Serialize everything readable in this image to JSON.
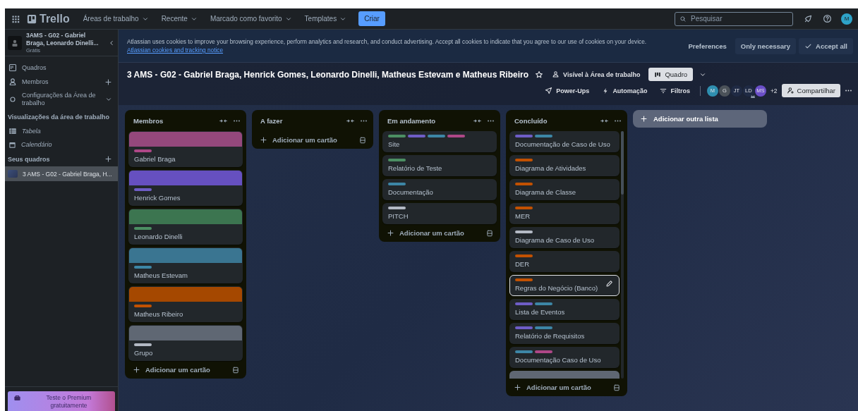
{
  "topbar": {
    "logo": "Trello",
    "menus": [
      {
        "label": "Áreas de trabalho"
      },
      {
        "label": "Recente"
      },
      {
        "label": "Marcado como favorito"
      },
      {
        "label": "Templates"
      }
    ],
    "create_button": "Criar",
    "search": {
      "placeholder": "Pesquisar"
    },
    "avatar": {
      "initials": "M",
      "color": "#2ea3c8"
    }
  },
  "sidebar": {
    "workspace": {
      "name": "3AMS - G02 - Gabriel Braga, Leonardo Dinelli...",
      "plan": "Grátis"
    },
    "items": [
      {
        "kind": "boards",
        "label": "Quadros"
      },
      {
        "kind": "members",
        "label": "Membros"
      },
      {
        "kind": "settings",
        "label": "Configurações da Área de trabalho"
      }
    ],
    "views_heading": "Visualizações da área de trabalho",
    "views": [
      {
        "kind": "table",
        "label": "Tabela"
      },
      {
        "kind": "calendar",
        "label": "Calendário"
      }
    ],
    "boards_heading": "Seus quadros",
    "boards": [
      {
        "label": "3 AMS - G02 - Gabriel Braga, H...",
        "selected": true
      }
    ],
    "premium": "Teste o Premium gratuitamente"
  },
  "cookie_banner": {
    "text": "Atlassian uses cookies to improve your browsing experience, perform analytics and research, and conduct advertising. Accept all cookies to indicate that you agree to our use of cookies on your device.",
    "link": "Atlassian cookies and tracking notice",
    "buttons": [
      {
        "kind": "plain",
        "label": "Preferences"
      },
      {
        "kind": "filled",
        "label": "Only necessary"
      },
      {
        "kind": "check",
        "label": "Accept all"
      }
    ]
  },
  "board_header": {
    "title": "3 AMS - G02 - Gabriel Braga, Henrick Gomes, Leonardo Dinelli, Matheus Estevam e Matheus Ribeiro",
    "visibility": "Visível à Área de trabalho",
    "view_button": "Quadro",
    "actions": [
      {
        "kind": "power-ups",
        "label": "Power-Ups"
      },
      {
        "kind": "automation",
        "label": "Automação"
      },
      {
        "kind": "filter",
        "label": "Filtros"
      }
    ],
    "members": [
      {
        "initials": "M",
        "color": "#2f8fb0",
        "admin": false
      },
      {
        "initials": "G",
        "color": "#4b5259",
        "admin": false
      },
      {
        "initials": "JT",
        "color": "#1f2a44",
        "admin": false
      },
      {
        "initials": "LD",
        "color": "#1f2a44",
        "admin": true
      },
      {
        "initials": "MS",
        "color": "#6b4fc8",
        "admin": false
      }
    ],
    "more_members": "+2",
    "share_button": "Compartilhar"
  },
  "lists": [
    {
      "title": "Membros",
      "add_card": "Adicionar um cartão",
      "cards": [
        {
          "kind": "cover",
          "color": "#94487c",
          "labels": [
            {
              "color": "#ae4787"
            }
          ],
          "title": "Gabriel Braga",
          "selected": false
        },
        {
          "kind": "cover",
          "color": "#6650c0",
          "labels": [
            {
              "color": "#6e5dc6"
            }
          ],
          "title": "Henrick Gomes",
          "selected": false
        },
        {
          "kind": "cover",
          "color": "#3c7550",
          "labels": [
            {
              "color": "#4c8f63"
            }
          ],
          "title": "Leonardo Dinelli",
          "selected": false
        },
        {
          "kind": "cover",
          "color": "#3a7591",
          "labels": [
            {
              "color": "#3d86a6"
            }
          ],
          "title": "Matheus Estevam",
          "selected": false
        },
        {
          "kind": "cover",
          "color": "#a54800",
          "labels": [
            {
              "color": "#c25100"
            }
          ],
          "title": "Matheus Ribeiro",
          "selected": false
        },
        {
          "kind": "cover",
          "color": "#5f6773",
          "labels": [
            {
              "color": "#b3b9c4"
            }
          ],
          "title": "Grupo",
          "selected": false
        }
      ]
    },
    {
      "title": "A fazer",
      "add_card": "Adicionar um cartão"
    },
    {
      "title": "Em andamento",
      "add_card": "Adicionar um cartão",
      "cards": [
        {
          "kind": "plain",
          "labels": [
            {
              "color": "#4c8f63"
            },
            {
              "color": "#6e5dc6"
            },
            {
              "color": "#3d86a6"
            },
            {
              "color": "#ae4787"
            }
          ],
          "title": "Site",
          "selected": false
        },
        {
          "kind": "plain",
          "labels": [
            {
              "color": "#4c8f63"
            }
          ],
          "title": "Relatório de Teste",
          "selected": false
        },
        {
          "kind": "plain",
          "labels": [
            {
              "color": "#3d86a6"
            }
          ],
          "title": "Documentação",
          "selected": false
        },
        {
          "kind": "plain",
          "labels": [
            {
              "color": "#b3b9c4"
            }
          ],
          "title": "PITCH",
          "selected": false
        }
      ]
    },
    {
      "title": "Concluído",
      "add_card": "Adicionar um cartão",
      "cards": [
        {
          "kind": "plain",
          "labels": [
            {
              "color": "#6e5dc6"
            },
            {
              "color": "#3d86a6"
            }
          ],
          "title": "Documentação de Caso de Uso",
          "selected": false
        },
        {
          "kind": "plain",
          "labels": [
            {
              "color": "#c25100"
            }
          ],
          "title": "Diagrama de Atividades",
          "selected": false
        },
        {
          "kind": "plain",
          "labels": [
            {
              "color": "#c25100"
            }
          ],
          "title": "Diagrama de Classe",
          "selected": false
        },
        {
          "kind": "plain",
          "labels": [
            {
              "color": "#c25100"
            }
          ],
          "title": "MER",
          "selected": false
        },
        {
          "kind": "plain",
          "labels": [
            {
              "color": "#b3b9c4"
            }
          ],
          "title": "Diagrama de Caso de Uso",
          "selected": false
        },
        {
          "kind": "plain",
          "labels": [
            {
              "color": "#c25100"
            }
          ],
          "title": "DER",
          "selected": false
        },
        {
          "kind": "plain",
          "labels": [
            {
              "color": "#c25100"
            }
          ],
          "title": "Regras do Negócio (Banco)",
          "selected": true
        },
        {
          "kind": "plain",
          "labels": [
            {
              "color": "#6e5dc6"
            },
            {
              "color": "#3d86a6"
            }
          ],
          "title": "Lista de Eventos",
          "selected": false
        },
        {
          "kind": "plain",
          "labels": [
            {
              "color": "#6e5dc6"
            },
            {
              "color": "#3d86a6"
            }
          ],
          "title": "Relatório de Requisitos",
          "selected": false
        },
        {
          "kind": "plain",
          "labels": [
            {
              "color": "#3d86a6"
            },
            {
              "color": "#ae4787"
            }
          ],
          "title": "Documentação Caso de Uso",
          "selected": false
        },
        {
          "kind": "partial",
          "color": "#5f6773",
          "selected": false
        }
      ]
    }
  ],
  "add_list": "Adicionar outra lista"
}
